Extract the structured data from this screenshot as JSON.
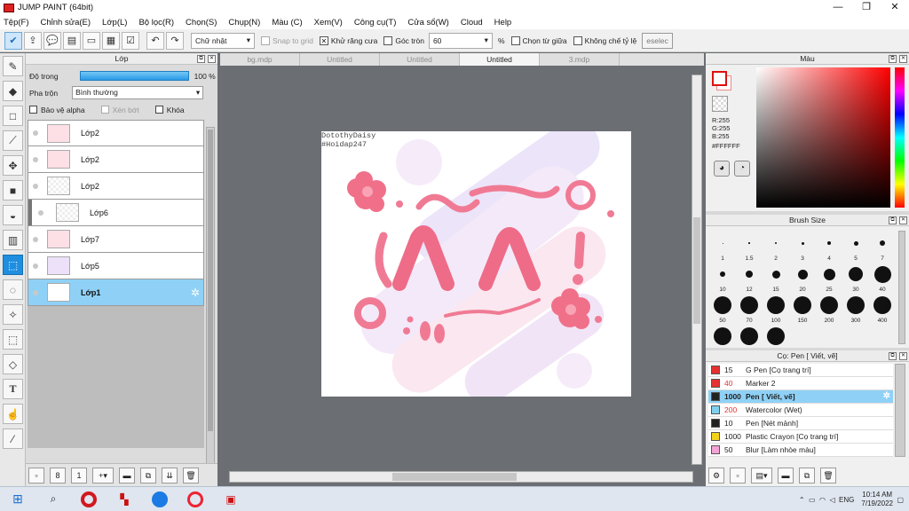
{
  "window": {
    "title": "JUMP PAINT (64bit)",
    "minimize": "—",
    "maximize": "❐",
    "close": "✕"
  },
  "menu": [
    "Tệp(F)",
    "Chỉnh sửa(E)",
    "Lớp(L)",
    "Bộ lọc(R)",
    "Chọn(S)",
    "Chụp(N)",
    "Màu (C)",
    "Xem(V)",
    "Công cụ(T)",
    "Cửa sổ(W)",
    "Cloud",
    "Help"
  ],
  "toolbar": {
    "shape_select": "Chữ nhật",
    "snap_to_grid": "Snap to grid",
    "antialias": "Khử răng cưa",
    "round_corner": "Góc tròn",
    "round_value": "60",
    "percent": "%",
    "select_center": "Chọn từ giữa",
    "fixed_ratio": "Không chế tỷ lệ",
    "deselect": "eselec"
  },
  "layers_panel": {
    "title": "Lớp",
    "opacity_label": "Độ trong",
    "opacity_value": "100 %",
    "opacity_fraction": 1.0,
    "blend_label": "Pha trộn",
    "blend_value": "Bình thường",
    "protect_alpha": "Bảo vệ alpha",
    "clipping": "Xén bớt",
    "lock": "Khóa",
    "layers": [
      {
        "name": "Lớp2",
        "thumb": "pink"
      },
      {
        "name": "Lớp2",
        "thumb": "pink"
      },
      {
        "name": "Lớp2",
        "thumb": "checker"
      },
      {
        "name": "Lớp6",
        "thumb": "checker"
      },
      {
        "name": "Lớp7",
        "thumb": "pink"
      },
      {
        "name": "Lớp5",
        "thumb": "lav"
      },
      {
        "name": "Lớp1",
        "thumb": "white"
      }
    ]
  },
  "tabs": [
    "bg.mdp",
    "Untitled",
    "Untitled",
    "Untitled",
    "3.mdp"
  ],
  "canvas": {
    "watermark_line1": "DotothyDaisy",
    "watermark_line2": "#Hoidap247"
  },
  "color_panel": {
    "title": "Màu",
    "r": "R:255",
    "g": "G:255",
    "b": "B:255",
    "hex": "#FFFFFF",
    "fg_color": "#ffffff",
    "accent": "#e02020"
  },
  "brush_panel": {
    "title": "Brush Size",
    "sizes": [
      "1",
      "1.5",
      "2",
      "3",
      "4",
      "5",
      "7",
      "10",
      "12",
      "15",
      "20",
      "25",
      "30",
      "40",
      "50",
      "70",
      "100",
      "150",
      "200",
      "300",
      "400",
      "",
      "",
      ""
    ]
  },
  "tool_panel": {
    "title": "Cọ: Pen [ Viết, vẽ]",
    "items": [
      {
        "size": "15",
        "name": "G Pen [Cọ trang trí]",
        "color": "#e53030",
        "red": false
      },
      {
        "size": "40",
        "name": "Marker 2",
        "color": "#e53030",
        "red": true
      },
      {
        "size": "1000",
        "name": "Pen [ Viết, vẽ]",
        "color": "#222222",
        "red": false
      },
      {
        "size": "200",
        "name": "Watercolor (Wet)",
        "color": "#7fd0ee",
        "red": true
      },
      {
        "size": "10",
        "name": "Pen [Nét mảnh]",
        "color": "#222222",
        "red": false
      },
      {
        "size": "1000",
        "name": "Plastic Crayon [Cọ trang trí]",
        "color": "#f2d21b",
        "red": false
      },
      {
        "size": "50",
        "name": "Blur [Làm nhòe màu]",
        "color": "#f4a3d6",
        "red": false
      }
    ]
  },
  "taskbar": {
    "time": "10:14 AM",
    "date": "7/19/2022",
    "lang": "ENG"
  }
}
